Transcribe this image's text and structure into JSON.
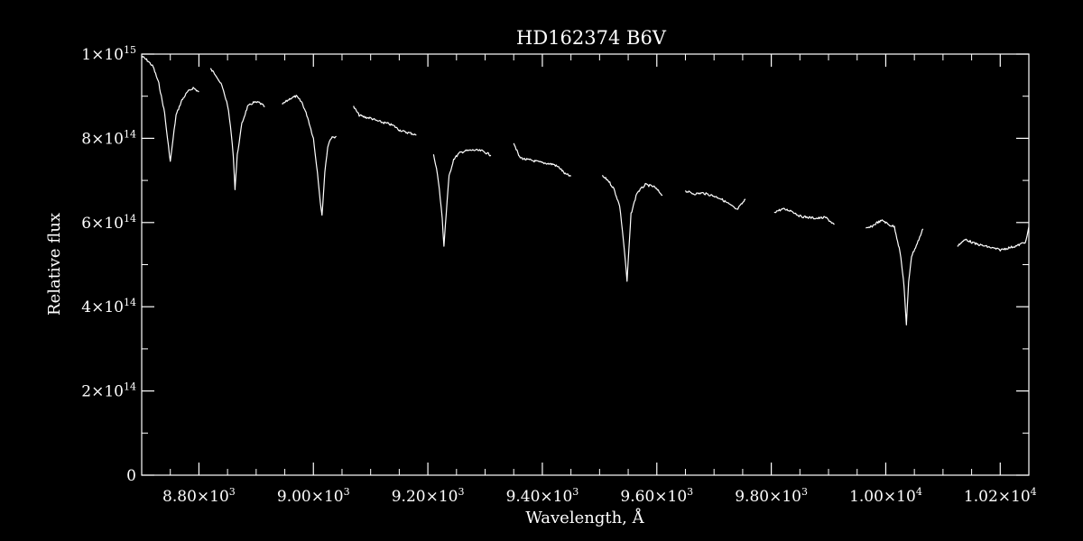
{
  "chart_data": {
    "type": "line",
    "title": "HD162374   B6V",
    "xlabel": "Wavelength, Å",
    "ylabel": "Relative flux",
    "xlim": [
      8700,
      10250
    ],
    "ylim": [
      0,
      1000000000000000.0
    ],
    "grid": false,
    "x_ticks": [
      {
        "value": 8800,
        "mant": "8.80×10",
        "exp": "3"
      },
      {
        "value": 9000,
        "mant": "9.00×10",
        "exp": "3"
      },
      {
        "value": 9200,
        "mant": "9.20×10",
        "exp": "3"
      },
      {
        "value": 9400,
        "mant": "9.40×10",
        "exp": "3"
      },
      {
        "value": 9600,
        "mant": "9.60×10",
        "exp": "3"
      },
      {
        "value": 9800,
        "mant": "9.80×10",
        "exp": "3"
      },
      {
        "value": 10000,
        "mant": "1.00×10",
        "exp": "4"
      },
      {
        "value": 10200,
        "mant": "1.02×10",
        "exp": "4"
      }
    ],
    "y_ticks": [
      {
        "value": 0,
        "mant": "0",
        "exp": ""
      },
      {
        "value": 200000000000000.0,
        "mant": "2×10",
        "exp": "14"
      },
      {
        "value": 400000000000000.0,
        "mant": "4×10",
        "exp": "14"
      },
      {
        "value": 600000000000000.0,
        "mant": "6×10",
        "exp": "14"
      },
      {
        "value": 800000000000000.0,
        "mant": "8×10",
        "exp": "14"
      },
      {
        "value": 1000000000000000.0,
        "mant": "1×10",
        "exp": "15"
      }
    ],
    "series": [
      {
        "x": [
          8700,
          8710,
          8720,
          8730,
          8740,
          8745,
          8750,
          8755,
          8760,
          8770,
          8780,
          8790,
          8800
        ],
        "y": [
          995000000000000.0,
          985000000000000.0,
          970000000000000.0,
          930000000000000.0,
          860000000000000.0,
          800000000000000.0,
          745000000000000.0,
          800000000000000.0,
          855000000000000.0,
          890000000000000.0,
          910000000000000.0,
          920000000000000.0,
          910000000000000.0
        ]
      },
      {
        "x": [
          8820,
          8830,
          8840,
          8850,
          8855,
          8860,
          8863,
          8867,
          8875,
          8885,
          8895,
          8905,
          8915
        ],
        "y": [
          965000000000000.0,
          950000000000000.0,
          925000000000000.0,
          880000000000000.0,
          830000000000000.0,
          760000000000000.0,
          680000000000000.0,
          760000000000000.0,
          835000000000000.0,
          875000000000000.0,
          885000000000000.0,
          885000000000000.0,
          875000000000000.0
        ]
      },
      {
        "x": [
          8945,
          8960,
          8970,
          8980,
          8990,
          9000,
          9007,
          9012,
          9015,
          9020,
          9025,
          9030,
          9040
        ],
        "y": [
          880000000000000.0,
          895000000000000.0,
          900000000000000.0,
          885000000000000.0,
          850000000000000.0,
          800000000000000.0,
          720000000000000.0,
          650000000000000.0,
          615000000000000.0,
          720000000000000.0,
          780000000000000.0,
          800000000000000.0,
          805000000000000.0
        ]
      },
      {
        "x": [
          9070,
          9080,
          9090,
          9100,
          9110,
          9120,
          9130,
          9140,
          9150,
          9160,
          9170,
          9180
        ],
        "y": [
          875000000000000.0,
          855000000000000.0,
          850000000000000.0,
          848000000000000.0,
          842000000000000.0,
          838000000000000.0,
          835000000000000.0,
          830000000000000.0,
          820000000000000.0,
          815000000000000.0,
          812000000000000.0,
          808000000000000.0
        ]
      },
      {
        "x": [
          9210,
          9215,
          9220,
          9225,
          9228,
          9232,
          9237,
          9245,
          9255,
          9265,
          9280,
          9295,
          9310
        ],
        "y": [
          760000000000000.0,
          730000000000000.0,
          680000000000000.0,
          610000000000000.0,
          545000000000000.0,
          620000000000000.0,
          710000000000000.0,
          750000000000000.0,
          765000000000000.0,
          770000000000000.0,
          772000000000000.0,
          770000000000000.0,
          760000000000000.0
        ]
      },
      {
        "x": [
          9350,
          9360,
          9370,
          9380,
          9390,
          9400,
          9410,
          9420,
          9430,
          9440,
          9450
        ],
        "y": [
          790000000000000.0,
          755000000000000.0,
          750000000000000.0,
          748000000000000.0,
          745000000000000.0,
          742000000000000.0,
          740000000000000.0,
          738000000000000.0,
          730000000000000.0,
          715000000000000.0,
          710000000000000.0
        ]
      },
      {
        "x": [
          9505,
          9515,
          9525,
          9535,
          9540,
          9545,
          9548,
          9551,
          9555,
          9565,
          9580,
          9595,
          9610
        ],
        "y": [
          710000000000000.0,
          700000000000000.0,
          680000000000000.0,
          640000000000000.0,
          580000000000000.0,
          510000000000000.0,
          460000000000000.0,
          530000000000000.0,
          620000000000000.0,
          670000000000000.0,
          690000000000000.0,
          685000000000000.0,
          665000000000000.0
        ]
      },
      {
        "x": [
          9650,
          9665,
          9680,
          9695,
          9710,
          9725,
          9740,
          9755
        ],
        "y": [
          675000000000000.0,
          668000000000000.0,
          670000000000000.0,
          665000000000000.0,
          658000000000000.0,
          645000000000000.0,
          630000000000000.0,
          655000000000000.0
        ]
      },
      {
        "x": [
          9805,
          9820,
          9835,
          9850,
          9865,
          9880,
          9895,
          9910
        ],
        "y": [
          625000000000000.0,
          632000000000000.0,
          628000000000000.0,
          615000000000000.0,
          612000000000000.0,
          610000000000000.0,
          612000000000000.0,
          595000000000000.0
        ]
      },
      {
        "x": [
          9965,
          9975,
          9985,
          9995,
          10005,
          10015,
          10025,
          10032,
          10036,
          10040,
          10045,
          10055,
          10065
        ],
        "y": [
          585000000000000.0,
          590000000000000.0,
          600000000000000.0,
          605000000000000.0,
          595000000000000.0,
          590000000000000.0,
          530000000000000.0,
          450000000000000.0,
          355000000000000.0,
          460000000000000.0,
          520000000000000.0,
          550000000000000.0,
          585000000000000.0
        ]
      },
      {
        "x": [
          10125,
          10140,
          10155,
          10170,
          10185,
          10200,
          10215,
          10230,
          10245,
          10250
        ],
        "y": [
          545000000000000.0,
          560000000000000.0,
          550000000000000.0,
          545000000000000.0,
          540000000000000.0,
          535000000000000.0,
          540000000000000.0,
          545000000000000.0,
          555000000000000.0,
          590000000000000.0
        ]
      }
    ]
  }
}
